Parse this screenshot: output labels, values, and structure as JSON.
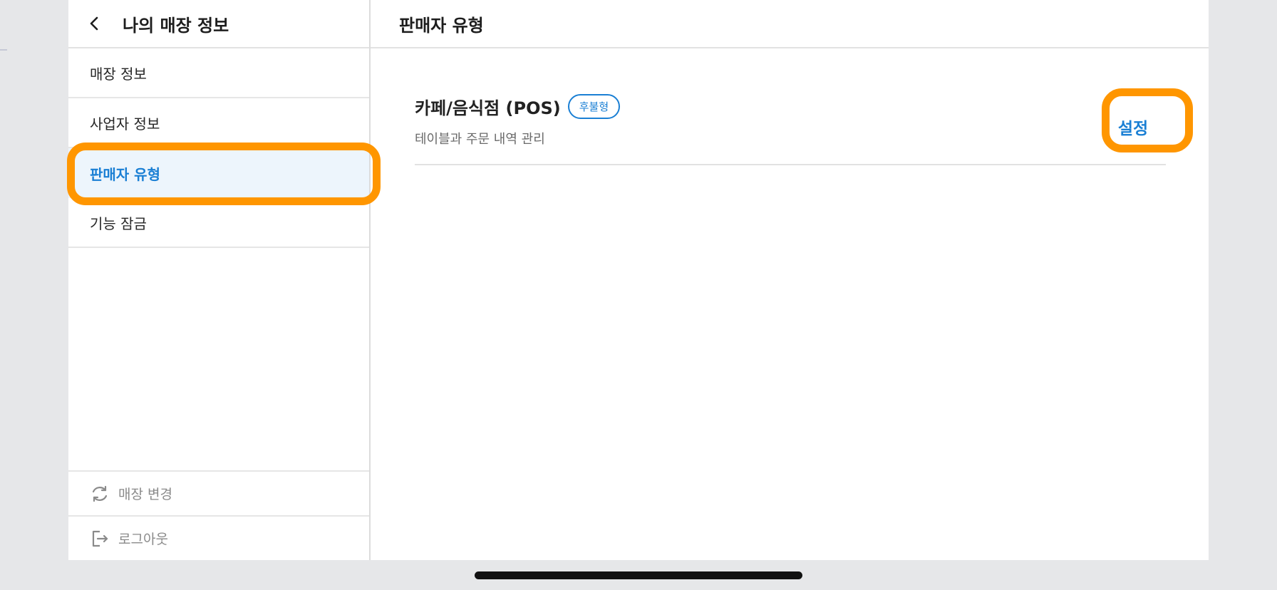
{
  "left_pane": {
    "title": "나의 매장 정보",
    "menu": [
      {
        "label": "매장 정보"
      },
      {
        "label": "사업자 정보"
      },
      {
        "label": "판매자 유형"
      },
      {
        "label": "기능 잠금"
      }
    ],
    "bottom": {
      "change_store": "매장 변경",
      "logout": "로그아웃"
    }
  },
  "right_pane": {
    "title": "판매자 유형",
    "card": {
      "title": "카페/음식점 (POS)",
      "badge": "후불형",
      "subtitle": "테이블과 주문 내역 관리",
      "button": "설정"
    }
  },
  "colors": {
    "accent": "#1a7fd4",
    "highlight": "#ff9600",
    "active_bg": "#edf5fc"
  },
  "icons": [
    "chevron-left-icon",
    "refresh-icon",
    "logout-icon"
  ]
}
